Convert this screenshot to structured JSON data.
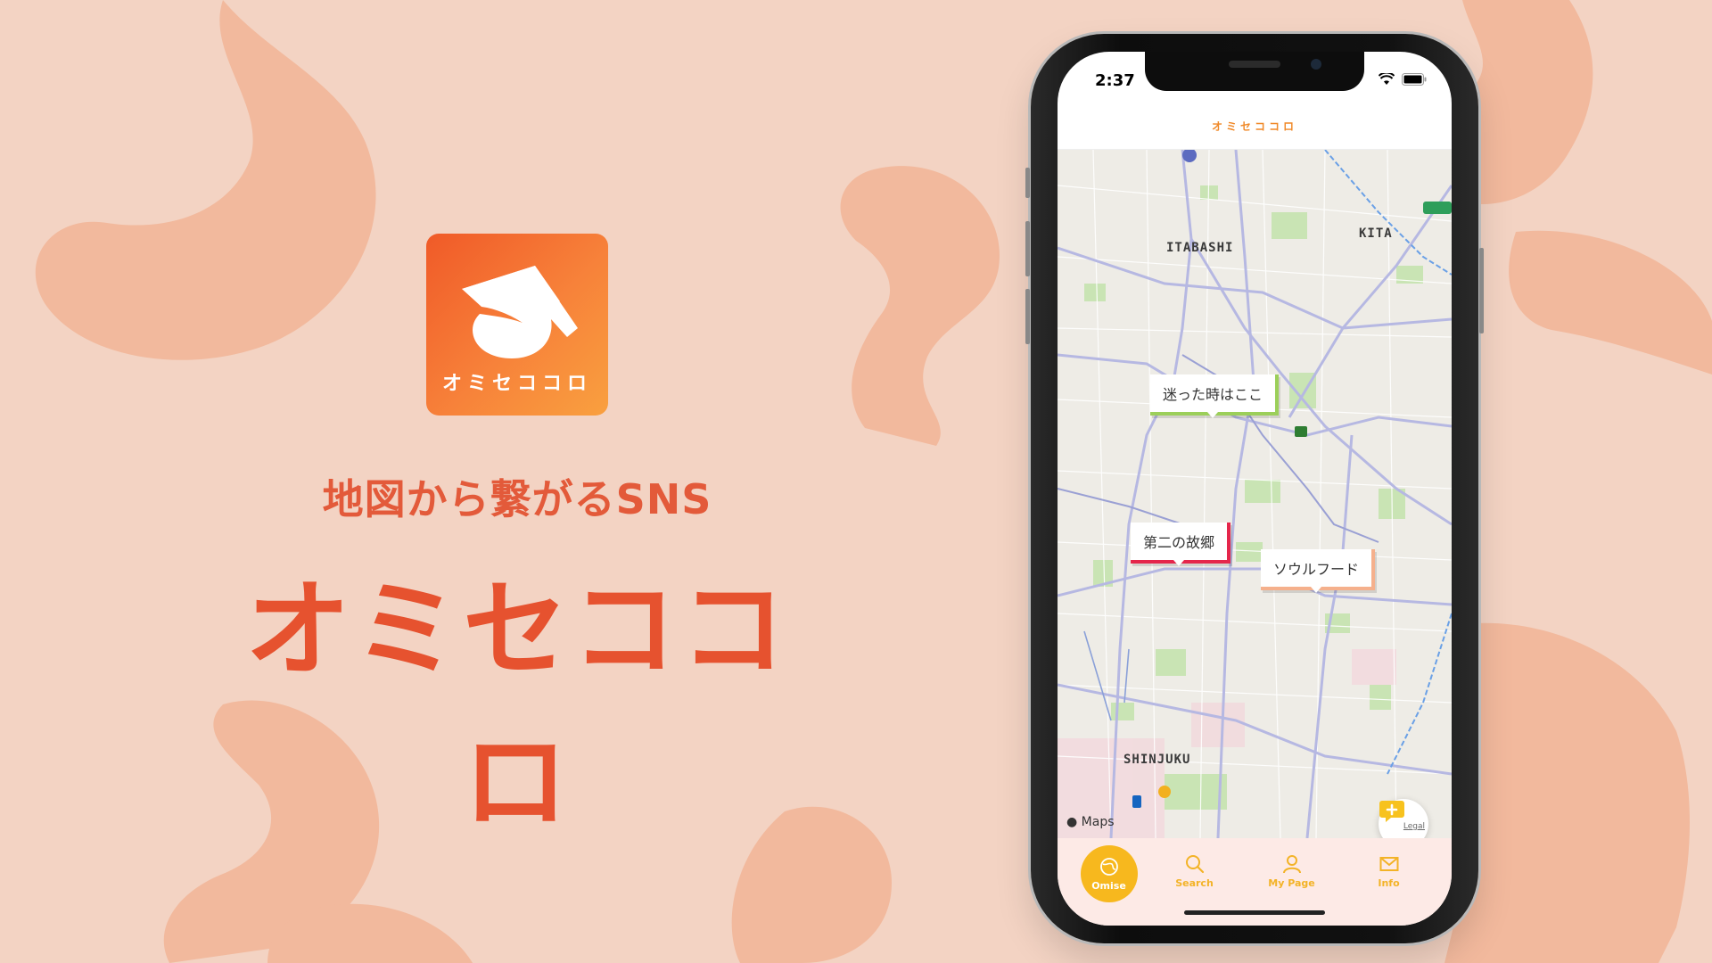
{
  "brand": {
    "icon_text": "オミセココロ",
    "tagline": "地図から繋がるSNS",
    "title": "オミセココロ",
    "colors": {
      "primary": "#e6522f",
      "accent": "#f7b81e",
      "background": "#f3d3c3"
    }
  },
  "phone": {
    "status_time": "2:37",
    "header_title": "オミセココロ",
    "map": {
      "districts": [
        "ITABASHI",
        "KITA",
        "SHINJUKU"
      ],
      "pins": [
        {
          "label": "迷った時はここ",
          "color": "#9ccf5a"
        },
        {
          "label": "第二の故郷",
          "color": "#e5264b"
        },
        {
          "label": "ソウルフード",
          "color": "#f5b08c"
        }
      ],
      "credit": "Maps",
      "legal": "Legal"
    },
    "tabs": [
      {
        "label": "Omise",
        "icon": "map-globe-icon"
      },
      {
        "label": "Search",
        "icon": "search-icon"
      },
      {
        "label": "My Page",
        "icon": "user-icon"
      },
      {
        "label": "Info",
        "icon": "mail-icon"
      }
    ]
  }
}
